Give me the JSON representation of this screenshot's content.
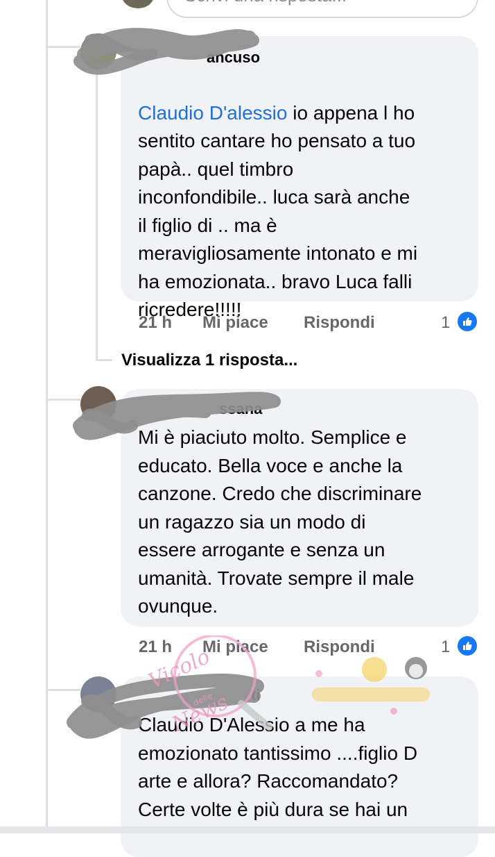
{
  "reply_input": {
    "placeholder": "Scrivi una risposta..."
  },
  "comments": [
    {
      "author_visible": "ancuso",
      "mention": "Claudio D'alessio",
      "text_after_mention": " io appena l ho\nsentito cantare ho pensato a tuo\npapà.. quel timbro\ninconfondibile.. luca sarà  anche\nil figlio di .. ma è\nmeravigliosamente intonato e mi\nha emozionata.. bravo Luca falli\nricredere!!!!!",
      "time": "21 h",
      "like_label": "Mi piace",
      "reply_label": "Rispondi",
      "reactions": "1"
    },
    {
      "author_visible": "ssana",
      "text": "Mi è piaciuto molto. Semplice e\neducato. Bella voce e anche la\ncanzone. Credo che discriminare\nun ragazzo sia un modo di\nessere arrogante e senza un\numanità. Trovate sempre il male\novunque.",
      "time": "21 h",
      "like_label": "Mi piace",
      "reply_label": "Rispondi",
      "reactions": "1"
    },
    {
      "author_visible": "ti",
      "text": "Claudio D'Alessio a me ha\nemozionato tantissimo ....figlio D\narte e allora? Raccomandato?\nCerte volte è più dura se hai un"
    }
  ],
  "view_replies": "Visualizza 1 risposta...",
  "watermark": {
    "line1": "Vicolo",
    "line2": "delle",
    "line3": "News"
  },
  "colors": {
    "bubble": "#f0f2f5",
    "mention": "#216fdb",
    "like_blue": "#1877f2",
    "meta": "#65676b"
  },
  "icons": [
    "like-thumb-icon",
    "avatar-placeholder"
  ]
}
